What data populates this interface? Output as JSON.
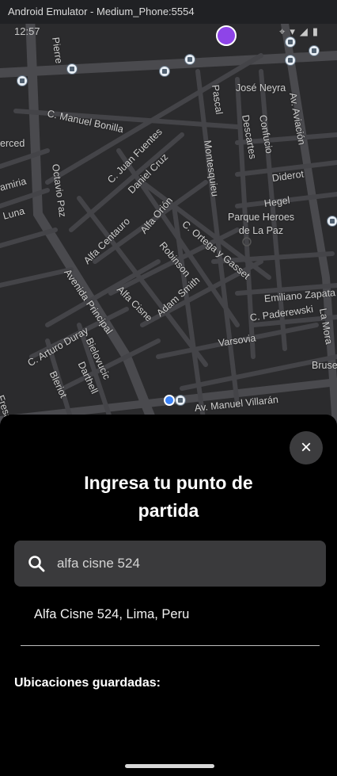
{
  "window": {
    "title": "Android Emulator - Medium_Phone:5554"
  },
  "status_bar": {
    "time": "12:57"
  },
  "map": {
    "streets": [
      "C. Manuel Bonilla",
      "C. Juan Fuentes",
      "Daniel Cruz",
      "Montesquieu",
      "Pascal",
      "José Neyra",
      "Descartes",
      "Confucio",
      "Av. Aviación",
      "Diderot",
      "Hegel",
      "Parque Heroes de La Paz",
      "Octavio Paz",
      "Alfa Orión",
      "Robinson",
      "C. Ortega y Gasset",
      "Alfa Centauro",
      "Avenida Principal",
      "Alfa Cisne",
      "Adam Smith",
      "Emiliano Zapata",
      "C. Paderewski",
      "La Mora",
      "Varsovia",
      "C. Arturo Duray",
      "Bielovucic",
      "Darthell",
      "Bleriot",
      "Av. Manuel Villarán",
      "Bruse",
      "erced",
      "amiria",
      "Luna",
      "Fresa",
      "Pierre"
    ]
  },
  "sheet": {
    "close_icon": "×",
    "heading": "Ingresa tu punto de partida",
    "search_value": "alfa cisne 524",
    "result": "Alfa Cisne 524, Lima, Peru",
    "saved_label": "Ubicaciones guardadas:"
  },
  "colors": {
    "map_background": "#2b2b2d",
    "road": "#4e4e52",
    "sheet_background": "#000000",
    "search_background": "#3a3a3c",
    "location_pin": "#8e44e8",
    "current_location": "#3b82f6"
  }
}
